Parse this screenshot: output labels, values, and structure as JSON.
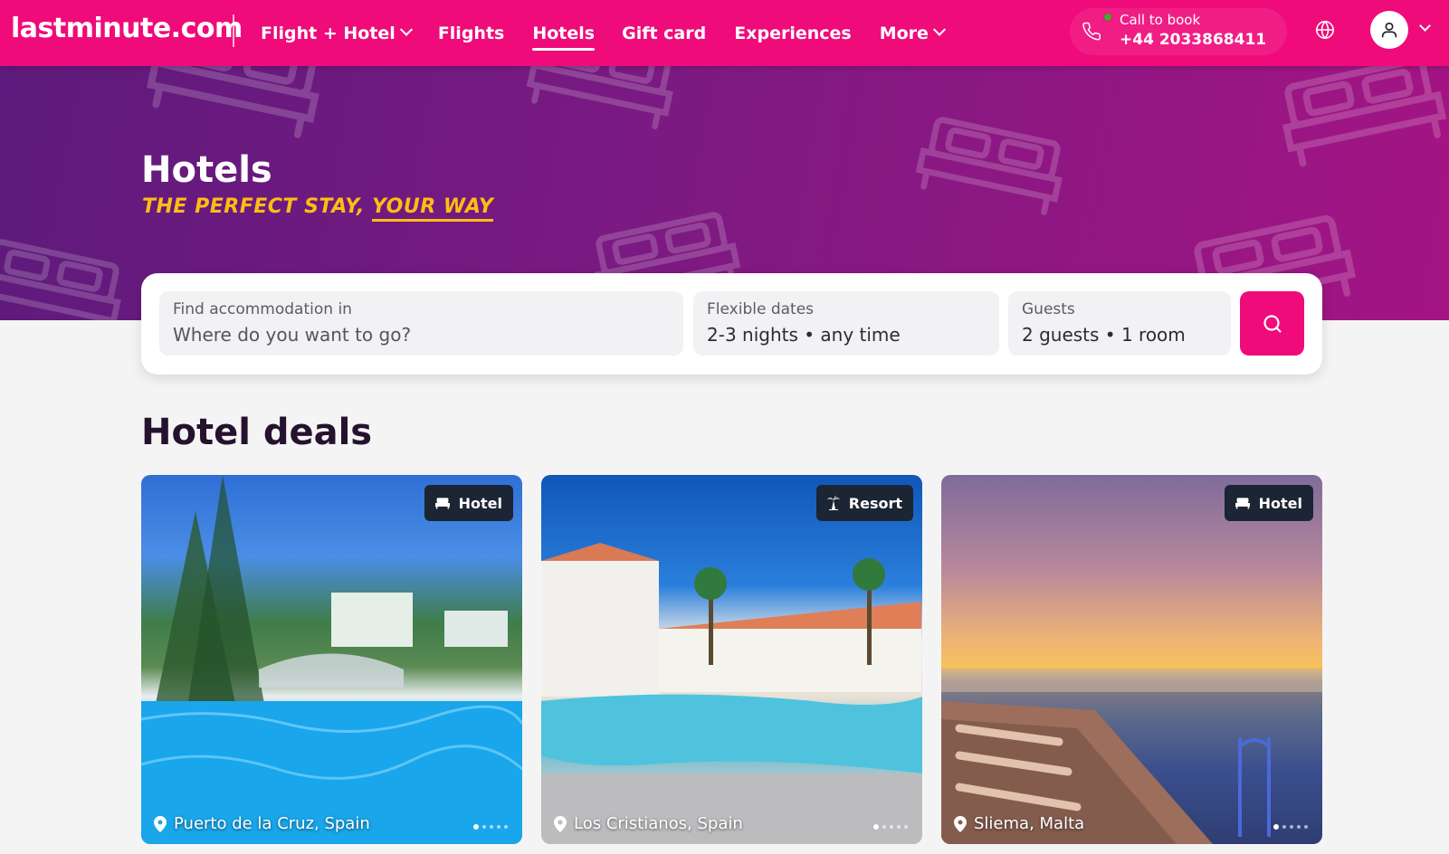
{
  "brand": {
    "logo": "lastminute.com",
    "accent": "#ef0b7a",
    "tagline_color": "#ffbd14"
  },
  "nav": {
    "items": [
      {
        "label": "Flight + Hotel",
        "dropdown": true
      },
      {
        "label": "Flights"
      },
      {
        "label": "Hotels",
        "active": true
      },
      {
        "label": "Gift card"
      },
      {
        "label": "Experiences"
      },
      {
        "label": "More",
        "dropdown": true
      }
    ],
    "call": {
      "label": "Call to book",
      "number": "+44 2033868411"
    },
    "icons": {
      "phone": "phone-icon",
      "globe": "globe-icon",
      "user": "user-icon"
    }
  },
  "hero": {
    "title": "Hotels",
    "tagline_part1": "THE PERFECT STAY,",
    "tagline_part2": "YOUR WAY"
  },
  "search": {
    "destination": {
      "label": "Find accommodation in",
      "placeholder": "Where do you want to go?"
    },
    "dates": {
      "label": "Flexible dates",
      "value": "2-3 nights • any time"
    },
    "guests": {
      "label": "Guests",
      "value": "2 guests • 1 room"
    },
    "button_icon": "search-icon"
  },
  "deals": {
    "title": "Hotel deals",
    "cards": [
      {
        "type": "Hotel",
        "type_icon": "bed-icon",
        "location": "Puerto de la Cruz, Spain"
      },
      {
        "type": "Resort",
        "type_icon": "palm-icon",
        "location": "Los Cristianos, Spain"
      },
      {
        "type": "Hotel",
        "type_icon": "bed-icon",
        "location": "Sliema, Malta"
      }
    ]
  }
}
